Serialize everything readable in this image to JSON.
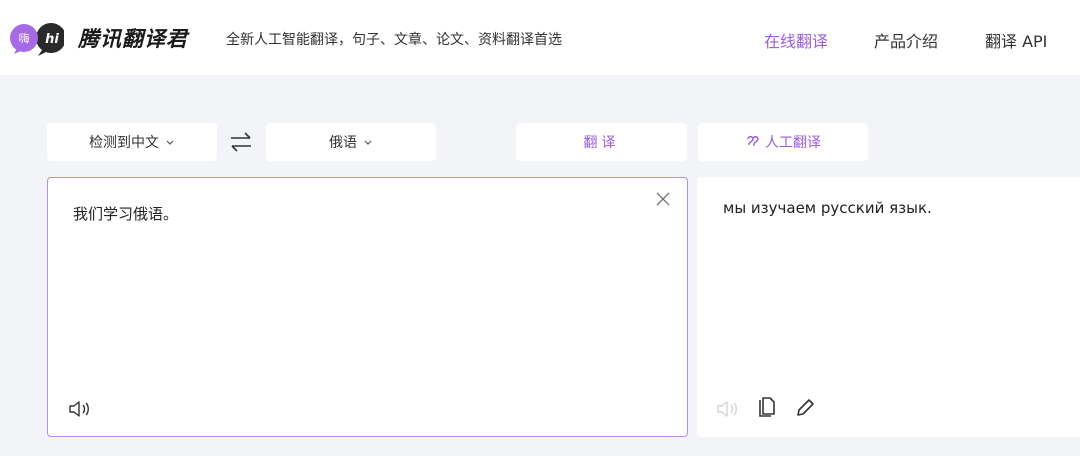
{
  "header": {
    "logo_badge_text": "嗨",
    "logo_hi_text": "hi",
    "logo_text": "腾讯翻译君",
    "tagline": "全新人工智能翻译，句子、文章、论文、资料翻译首选",
    "nav": [
      {
        "label": "在线翻译",
        "active": true
      },
      {
        "label": "产品介绍",
        "active": false
      },
      {
        "label": "翻译 API",
        "active": false
      }
    ]
  },
  "toolbar": {
    "source_lang": "检测到中文",
    "target_lang": "俄语",
    "translate_label": "翻译",
    "human_translate_label": "人工翻译"
  },
  "source": {
    "text": "我们学习俄语。"
  },
  "target": {
    "text": "мы изучаем русский язык."
  },
  "colors": {
    "accent": "#9b5de5",
    "background": "#f3f4f7",
    "panel": "#ffffff",
    "border_active": "#b48ff0"
  },
  "icons": [
    "logo-icon",
    "chevron-down-icon",
    "swap-icon",
    "human-translate-icon",
    "close-icon",
    "speaker-icon",
    "copy-icon",
    "edit-icon"
  ]
}
